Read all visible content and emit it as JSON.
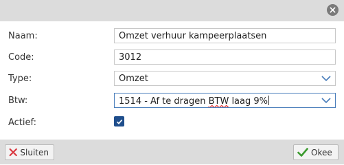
{
  "form": {
    "name": {
      "label": "Naam:",
      "value": "Omzet verhuur kampeerplaatsen"
    },
    "code": {
      "label": "Code:",
      "value": "3012"
    },
    "type": {
      "label": "Type:",
      "value": "Omzet"
    },
    "btw": {
      "label": "Btw:",
      "value_pre": "1514 - Af te dragen ",
      "value_mark": "BTW",
      "value_post": " laag 9%"
    },
    "active": {
      "label": "Actief:",
      "checked": true
    }
  },
  "footer": {
    "close_label": "Sluiten",
    "ok_label": "Okee"
  },
  "icons": {
    "dialog_close": "close-circle-icon",
    "chevron": "chevron-down-icon",
    "check": "checkmark-icon",
    "close_x": "red-x-icon",
    "ok_check": "green-check-icon"
  },
  "colors": {
    "checkbox_fill": "#1f4e8c",
    "focus_border": "#4a7ebb",
    "close_red": "#d9363e",
    "ok_green": "#3a9a2e"
  }
}
